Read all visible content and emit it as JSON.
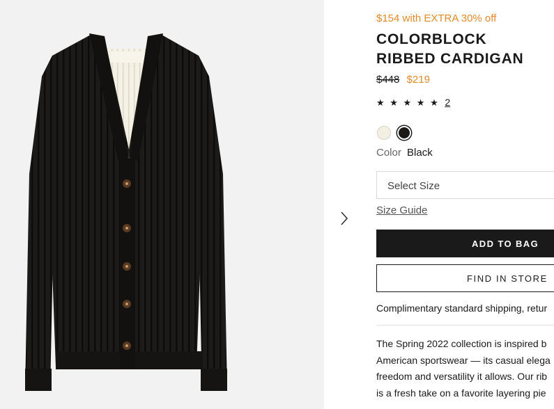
{
  "product": {
    "promo": "$154 with EXTRA 30% off",
    "title": "COLORBLOCK RIBBED CARDIGAN",
    "price_original": "$448",
    "price_sale": "$219",
    "rating_stars": "★ ★ ★ ★ ★",
    "rating_value": 5,
    "review_count": "2",
    "swatches": [
      {
        "name": "ivory",
        "color": "#f3efe2"
      },
      {
        "name": "black",
        "color": "#1c1a18",
        "selected": true
      }
    ],
    "color_label": "Color",
    "color_value": "Black",
    "size_placeholder": "Select Size",
    "size_guide": "Size Guide",
    "add_to_bag": "ADD TO BAG",
    "find_in_store": "FIND IN STORE",
    "shipping": "Complimentary standard shipping, retur",
    "description_lines": [
      "The Spring 2022 collection is inspired b",
      "American sportswear — its casual elega",
      "freedom and versatility it allows. Our rib",
      "is a fresh take on a favorite layering pie"
    ]
  },
  "gallery": {
    "next_icon": "chevron-right-icon",
    "background": "#f2f2f2"
  },
  "colors": {
    "accent": "#e38a2b",
    "primary": "#1a1a1a"
  }
}
